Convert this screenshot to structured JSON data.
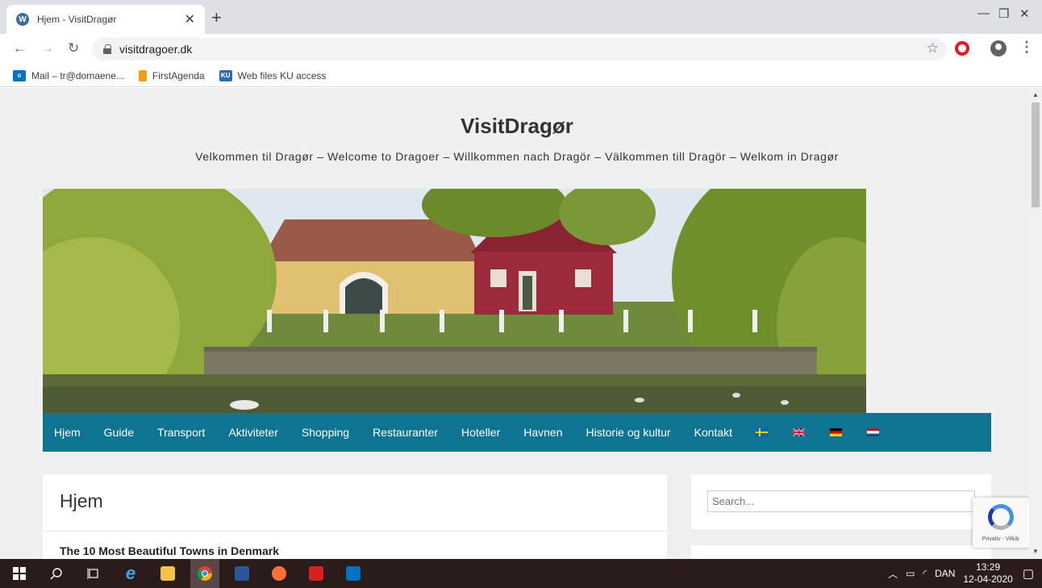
{
  "browser": {
    "tab_title": "Hjem - VisitDragør",
    "tab_favicon": "W",
    "url": "visitdragoer.dk",
    "bookmarks": [
      {
        "label": "Mail – tr@domaene...",
        "icon": "outlook-icon",
        "color": "#0072c6"
      },
      {
        "label": "FirstAgenda",
        "icon": "bookmark-flag-icon",
        "color": "#f39c12"
      },
      {
        "label": "Web files KU access",
        "icon": "web-files-icon",
        "color": "#2d6cb5"
      }
    ]
  },
  "site": {
    "title": "VisitDragør",
    "description": "Velkommen til Dragør – Welcome to Dragoer – Willkommen nach Dragör – Välkommen till Dragör – Welkom in Dragør",
    "nav": [
      "Hjem",
      "Guide",
      "Transport",
      "Aktiviteter",
      "Shopping",
      "Restauranter",
      "Hoteller",
      "Havnen",
      "Historie og kultur",
      "Kontakt"
    ],
    "flags": [
      "sweden-flag-icon",
      "uk-flag-icon",
      "germany-flag-icon",
      "netherlands-flag-icon"
    ],
    "nav_color": "#0f7392"
  },
  "content": {
    "page_title": "Hjem",
    "post_title": "The 10 Most Beautiful Towns in Denmark"
  },
  "sidebar": {
    "search_placeholder": "Search..."
  },
  "recaptcha": {
    "text": "Privativ - Vilkår"
  },
  "taskbar": {
    "language": "DAN",
    "time": "13:29",
    "date": "12-04-2020"
  }
}
